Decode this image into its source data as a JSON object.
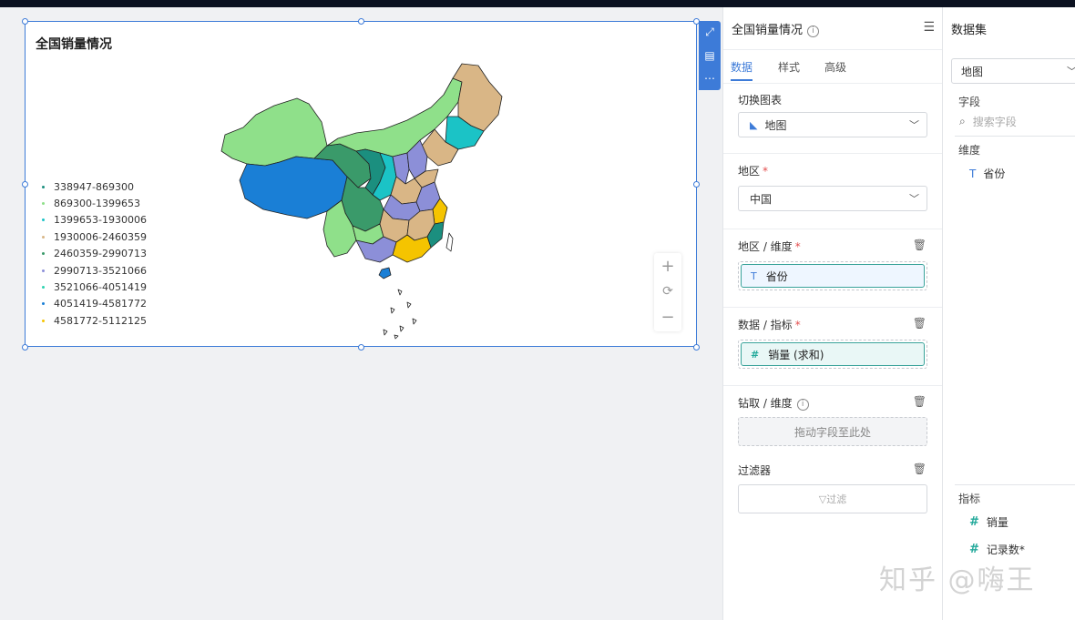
{
  "chart": {
    "title": "全国销量情况",
    "legend": [
      {
        "label": "338947-869300",
        "color": "#1b8f7f"
      },
      {
        "label": "869300-1399653",
        "color": "#8fe08a"
      },
      {
        "label": "1399653-1930006",
        "color": "#1bc3c6"
      },
      {
        "label": "1930006-2460359",
        "color": "#d9b686"
      },
      {
        "label": "2460359-2990713",
        "color": "#3a9a6a"
      },
      {
        "label": "2990713-3521066",
        "color": "#8c8fd8"
      },
      {
        "label": "3521066-4051419",
        "color": "#2fd3b0"
      },
      {
        "label": "4051419-4581772",
        "color": "#1a7fd6"
      },
      {
        "label": "4581772-5112125",
        "color": "#f5c400"
      }
    ],
    "zoom_in": "+",
    "zoom_reset": "⟳",
    "zoom_out": "−"
  },
  "side_tools": {
    "expand": "⤢",
    "doc": "▤",
    "more": "⋯"
  },
  "config": {
    "title": "全国销量情况",
    "tabs": [
      "数据",
      "样式",
      "高级"
    ],
    "switch_chart_label": "切换图表",
    "chart_type_value": "地图",
    "region_label": "地区",
    "region_value": "中国",
    "region_dim_label": "地区 / 维度",
    "region_dim_field": "省份",
    "metric_label": "数据 / 指标",
    "metric_field": "销量 (求和)",
    "drill_label": "钻取 / 维度",
    "drill_placeholder": "拖动字段至此处",
    "filter_label": "过滤器",
    "filter_button": "▽过滤"
  },
  "dataset": {
    "title": "数据集",
    "selected": "地图",
    "fields_label": "字段",
    "search_placeholder": "搜索字段",
    "dimension_label": "维度",
    "dimensions": [
      "省份"
    ],
    "metric_label": "指标",
    "metrics": [
      "销量",
      "记录数*"
    ]
  },
  "watermark": "知乎 @嗨王"
}
